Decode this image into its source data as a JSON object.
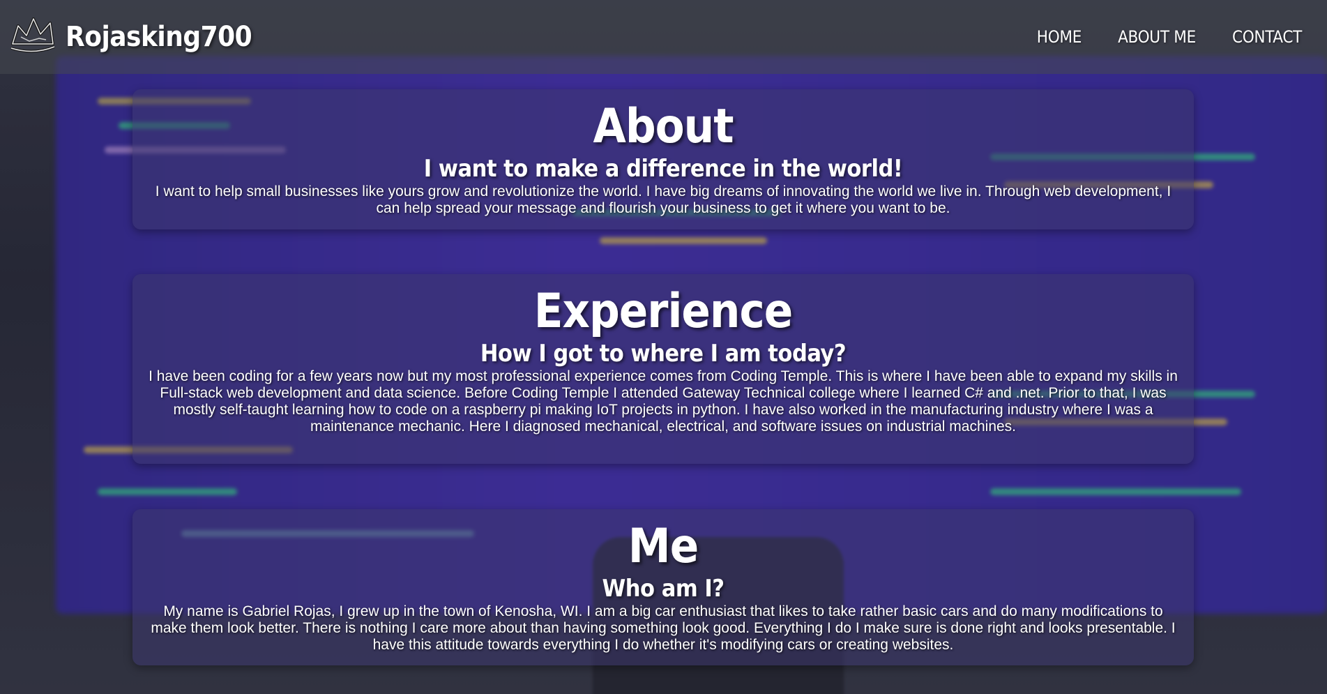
{
  "header": {
    "brand_name": "Rojasking700",
    "logo_icon": "crown-icon",
    "nav": [
      {
        "label": "HOME"
      },
      {
        "label": "ABOUT ME"
      },
      {
        "label": "CONTACT"
      }
    ]
  },
  "sections": {
    "about": {
      "title": "About",
      "subtitle": "I want to make a difference in the world!",
      "text": "I want to help small businesses like yours grow and revolutionize the world. I have big dreams of innovating the world we live in. Through web development, I can help spread your message and flourish your business to get it where you want to be."
    },
    "experience": {
      "title": "Experience",
      "subtitle": "How I got to where I am today?",
      "text": "I have been coding for a few years now but my most professional experience comes from Coding Temple. This is where I have been able to expand my skills in Full-stack web development and data science. Before Coding Temple I attended Gateway Technical college where I learned C# and .net. Prior to that, I was mostly self-taught learning how to code on a raspberry pi making IoT projects in python. I have also worked in the manufacturing industry where I was a maintenance mechanic. Here I diagnosed mechanical, electrical, and software issues on industrial machines."
    },
    "me": {
      "title": "Me",
      "subtitle": "Who am I?",
      "text": "My name is Gabriel Rojas, I grew up in the town of Kenosha, WI. I am a big car enthusiast that likes to take rather basic cars and do many modifications to make them look better. There is nothing I care more about than having something look good. Everything I do I make sure is done right and looks presentable. I have this attitude towards everything I do whether it's modifying cars or creating websites."
    }
  },
  "colors": {
    "card_bg": "#3c376e",
    "text": "#ffffff",
    "accent_green": "#3ddc97",
    "accent_yellow": "#e8c85a"
  }
}
